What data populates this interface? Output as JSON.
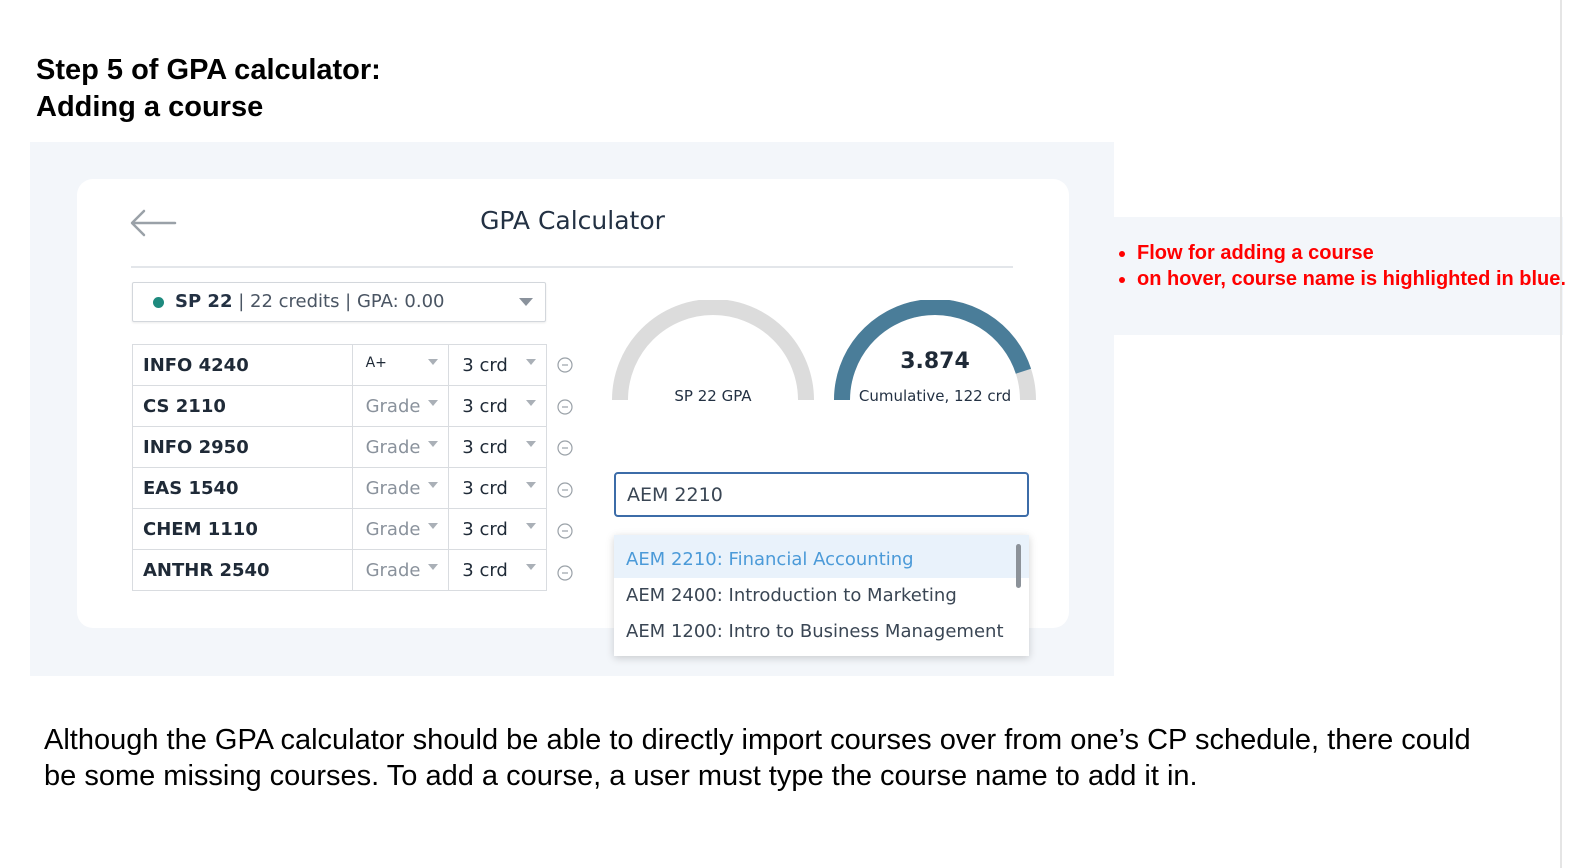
{
  "slide": {
    "title_line1": "Step 5 of GPA calculator:",
    "title_line2": "Adding a course",
    "notes": [
      "Flow for adding a course",
      "on hover, course name is highlighted in blue."
    ],
    "caption": "Although the GPA calculator should be able to directly import courses over from one’s CP schedule, there could be some missing courses. To add a course, a user must type the course name to add it in."
  },
  "app": {
    "title": "GPA Calculator",
    "back_icon": "arrow-left-icon",
    "semester": {
      "name": "SP 22",
      "details": " | 22 credits | GPA: 0.00",
      "status_color": "#1e8a7e"
    },
    "courses": [
      {
        "name": "INFO 4240",
        "grade": "A+",
        "credits": "3 crd"
      },
      {
        "name": "CS 2110",
        "grade": "Grade",
        "credits": "3 crd"
      },
      {
        "name": "INFO 2950",
        "grade": "Grade",
        "credits": "3 crd"
      },
      {
        "name": "EAS 1540",
        "grade": "Grade",
        "credits": "3 crd"
      },
      {
        "name": "CHEM 1110",
        "grade": "Grade",
        "credits": "3 crd"
      },
      {
        "name": "ANTHR 2540",
        "grade": "Grade",
        "credits": "3 crd"
      }
    ],
    "gauges": {
      "semester": {
        "label": "SP 22 GPA",
        "value": "",
        "fraction": 0,
        "color": "#dcdcdc"
      },
      "cumulative": {
        "label": "Cumulative, 122 crd",
        "value": "3.874",
        "fraction": 0.9,
        "color": "#4a7d99",
        "track": "#dcdcdc"
      }
    },
    "search": {
      "value": "AEM 2210"
    },
    "suggestions": [
      {
        "label": "AEM 2210: Financial Accounting",
        "hover": true
      },
      {
        "label": "AEM 2400: Introduction to Marketing",
        "hover": false
      },
      {
        "label": "AEM 1200: Intro to Business Management",
        "hover": false
      }
    ]
  }
}
